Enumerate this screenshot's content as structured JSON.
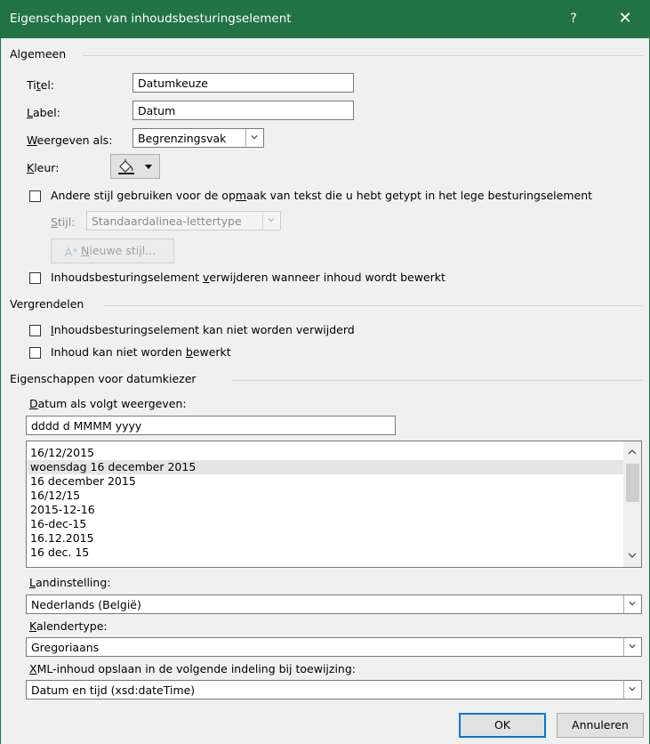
{
  "window": {
    "title": "Eigenschappen van inhoudsbesturingselement",
    "help": "?",
    "close": "✕",
    "accent": "#217346"
  },
  "general": {
    "group_title": "Algemeen",
    "title_label_pre": "Ti",
    "title_label_u": "t",
    "title_label_post": "el:",
    "title_value": "Datumkeuze",
    "tag_label_pre": "",
    "tag_label_u": "L",
    "tag_label_post": "abel:",
    "tag_value": "Datum",
    "show_as_label_pre": "",
    "show_as_label_u": "W",
    "show_as_label_post": "eergeven als:",
    "show_as_value": "Begrenzingsvak",
    "color_label_pre": "",
    "color_label_u": "K",
    "color_label_post": "leur:",
    "use_style_pre": "Andere stijl gebruiken voor de op",
    "use_style_u": "m",
    "use_style_post": "aak van tekst die u hebt getypt in het lege besturingselement",
    "style_label_pre": "",
    "style_label_u": "S",
    "style_label_post": "tijl:",
    "style_value": "Standaardalinea-lettertype",
    "new_style_pre": "",
    "new_style_u": "N",
    "new_style_post": "ieuwe stijl...",
    "remove_pre": "Inhoudsbesturingselement ",
    "remove_u": "v",
    "remove_post": "erwijderen wanneer inhoud wordt bewerkt"
  },
  "locking": {
    "group_title": "Vergrendelen",
    "cannot_delete_pre": "",
    "cannot_delete_u": "I",
    "cannot_delete_post": "nhoudsbesturingselement kan niet worden verwijderd",
    "cannot_edit_pre": "Inhoud kan niet worden ",
    "cannot_edit_u": "b",
    "cannot_edit_post": "ewerkt"
  },
  "date_picker": {
    "group_title": "Eigenschappen voor datumkiezer",
    "format_label_pre": "",
    "format_label_u": "D",
    "format_label_post": "atum als volgt weergeven:",
    "format_value": "dddd d MMMM yyyy",
    "formats": [
      "16/12/2015",
      "woensdag 16 december 2015",
      "16 december 2015",
      "16/12/15",
      "2015-12-16",
      "16-dec-15",
      "16.12.2015",
      "16 dec. 15"
    ],
    "selected_format_index": 1,
    "locale_label_pre": "",
    "locale_label_u": "L",
    "locale_label_post": "andinstelling:",
    "locale_value": "Nederlands (België)",
    "calendar_label_pre": "",
    "calendar_label_u": "K",
    "calendar_label_post": "alendertype:",
    "calendar_value": "Gregoriaans",
    "xml_label_pre": "",
    "xml_label_u": "X",
    "xml_label_post": "ML-inhoud opslaan in de volgende indeling bij toewijzing:",
    "xml_value": "Datum en tijd (xsd:dateTime)"
  },
  "buttons": {
    "ok": "OK",
    "cancel": "Annuleren"
  }
}
